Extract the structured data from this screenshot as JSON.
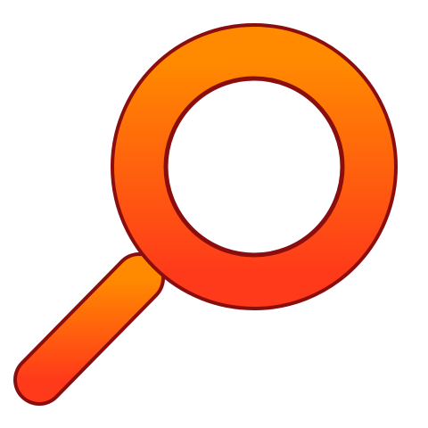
{
  "icon": {
    "name": "magnifying-glass-icon",
    "colors": {
      "fill_top": "#FF8A00",
      "fill_bottom": "#FF3A1A",
      "outline": "#8B0E0E",
      "lens": "#FFFFFF",
      "background": "#FFFFFF"
    }
  }
}
